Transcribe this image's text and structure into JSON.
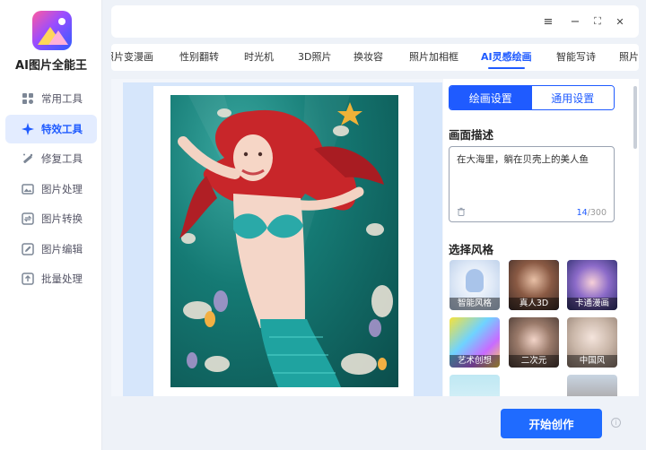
{
  "app": {
    "title": "AI图片全能王"
  },
  "sidebar": {
    "items": [
      {
        "label": "常用工具",
        "icon": "grid-icon"
      },
      {
        "label": "特效工具",
        "icon": "sparkle-icon",
        "active": true
      },
      {
        "label": "修复工具",
        "icon": "wand-icon"
      },
      {
        "label": "图片处理",
        "icon": "image-icon"
      },
      {
        "label": "图片转换",
        "icon": "convert-icon"
      },
      {
        "label": "图片编辑",
        "icon": "edit-icon"
      },
      {
        "label": "批量处理",
        "icon": "upload-icon"
      }
    ]
  },
  "window": {
    "menu_icon": "≡",
    "minimize_icon": "−",
    "maximize_icon": "⛶",
    "close_icon": "✕"
  },
  "tabs": [
    {
      "label": "照片变漫画"
    },
    {
      "label": "性别翻转"
    },
    {
      "label": "时光机"
    },
    {
      "label": "3D照片"
    },
    {
      "label": "换妆容"
    },
    {
      "label": "照片加相框"
    },
    {
      "label": "AI灵感绘画",
      "active": true
    },
    {
      "label": "智能写诗"
    },
    {
      "label": "照片"
    }
  ],
  "panel": {
    "seg_tabs": [
      {
        "label": "绘画设置",
        "active": true
      },
      {
        "label": "通用设置"
      }
    ],
    "desc_title": "画面描述",
    "desc_value": "在大海里，躺在贝壳上的美人鱼",
    "desc_count": "14",
    "desc_max": "/300",
    "style_title": "选择风格",
    "styles": [
      {
        "label": "智能风格"
      },
      {
        "label": "真人3D",
        "selected": true
      },
      {
        "label": "卡通漫画"
      },
      {
        "label": "艺术创想"
      },
      {
        "label": "二次元"
      },
      {
        "label": "中国风"
      }
    ]
  },
  "footer": {
    "create_label": "开始创作",
    "info_icon": "i"
  },
  "colors": {
    "accent": "#1f5bff",
    "active_bg": "#e3ecff"
  }
}
